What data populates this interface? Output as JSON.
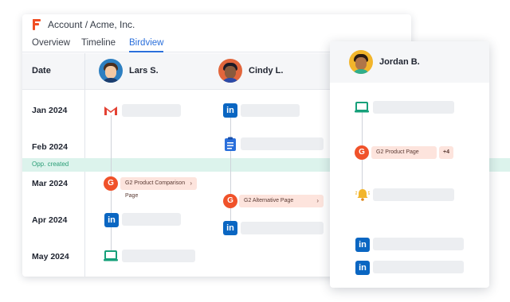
{
  "header": {
    "title": "Account / Acme, Inc."
  },
  "tabs": [
    {
      "label": "Overview"
    },
    {
      "label": "Timeline"
    },
    {
      "label": "Birdview",
      "active": true
    }
  ],
  "grid": {
    "date_header": "Date"
  },
  "people": [
    {
      "name": "Lars S.",
      "avatar_bg": "#2d7fc1"
    },
    {
      "name": "Cindy L.",
      "avatar_bg": "#e2663c"
    },
    {
      "name": "Jordan B.",
      "avatar_bg": "#f2b52b"
    }
  ],
  "dates": [
    "Jan 2024",
    "Feb 2024",
    "Mar 2024",
    "Apr 2024",
    "May 2024"
  ],
  "opportunity": {
    "label": "Opp. created"
  },
  "events": {
    "lars_g2": {
      "label": "G2 Product Comparison Page",
      "chevron": "›"
    },
    "cindy_g2": {
      "label": "G2 Alternative Page",
      "chevron": "›"
    },
    "jordan_g2": {
      "label": "G2 Product Page",
      "extra": "+4"
    }
  },
  "icons": {
    "linkedin": "in",
    "g2": "G",
    "mail": "gmail-icon",
    "laptop": "laptop-icon",
    "bell": "bell-icon",
    "checklist": "checklist-icon"
  },
  "colors": {
    "accent": "#2a6fdb",
    "linkedin": "#0a66c2",
    "g2": "#f0522a",
    "opp_band": "#dcf3ec",
    "opp_text": "#2a9d76"
  }
}
